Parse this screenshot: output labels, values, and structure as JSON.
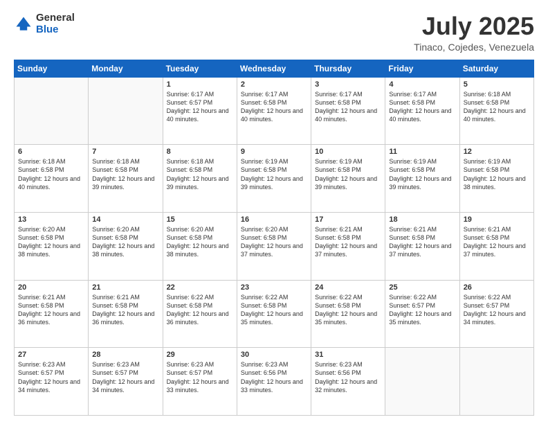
{
  "header": {
    "logo_general": "General",
    "logo_blue": "Blue",
    "month_title": "July 2025",
    "location": "Tinaco, Cojedes, Venezuela"
  },
  "weekdays": [
    "Sunday",
    "Monday",
    "Tuesday",
    "Wednesday",
    "Thursday",
    "Friday",
    "Saturday"
  ],
  "weeks": [
    [
      {
        "day": "",
        "sunrise": "",
        "sunset": "",
        "daylight": ""
      },
      {
        "day": "",
        "sunrise": "",
        "sunset": "",
        "daylight": ""
      },
      {
        "day": "1",
        "sunrise": "Sunrise: 6:17 AM",
        "sunset": "Sunset: 6:57 PM",
        "daylight": "Daylight: 12 hours and 40 minutes."
      },
      {
        "day": "2",
        "sunrise": "Sunrise: 6:17 AM",
        "sunset": "Sunset: 6:58 PM",
        "daylight": "Daylight: 12 hours and 40 minutes."
      },
      {
        "day": "3",
        "sunrise": "Sunrise: 6:17 AM",
        "sunset": "Sunset: 6:58 PM",
        "daylight": "Daylight: 12 hours and 40 minutes."
      },
      {
        "day": "4",
        "sunrise": "Sunrise: 6:17 AM",
        "sunset": "Sunset: 6:58 PM",
        "daylight": "Daylight: 12 hours and 40 minutes."
      },
      {
        "day": "5",
        "sunrise": "Sunrise: 6:18 AM",
        "sunset": "Sunset: 6:58 PM",
        "daylight": "Daylight: 12 hours and 40 minutes."
      }
    ],
    [
      {
        "day": "6",
        "sunrise": "Sunrise: 6:18 AM",
        "sunset": "Sunset: 6:58 PM",
        "daylight": "Daylight: 12 hours and 40 minutes."
      },
      {
        "day": "7",
        "sunrise": "Sunrise: 6:18 AM",
        "sunset": "Sunset: 6:58 PM",
        "daylight": "Daylight: 12 hours and 39 minutes."
      },
      {
        "day": "8",
        "sunrise": "Sunrise: 6:18 AM",
        "sunset": "Sunset: 6:58 PM",
        "daylight": "Daylight: 12 hours and 39 minutes."
      },
      {
        "day": "9",
        "sunrise": "Sunrise: 6:19 AM",
        "sunset": "Sunset: 6:58 PM",
        "daylight": "Daylight: 12 hours and 39 minutes."
      },
      {
        "day": "10",
        "sunrise": "Sunrise: 6:19 AM",
        "sunset": "Sunset: 6:58 PM",
        "daylight": "Daylight: 12 hours and 39 minutes."
      },
      {
        "day": "11",
        "sunrise": "Sunrise: 6:19 AM",
        "sunset": "Sunset: 6:58 PM",
        "daylight": "Daylight: 12 hours and 39 minutes."
      },
      {
        "day": "12",
        "sunrise": "Sunrise: 6:19 AM",
        "sunset": "Sunset: 6:58 PM",
        "daylight": "Daylight: 12 hours and 38 minutes."
      }
    ],
    [
      {
        "day": "13",
        "sunrise": "Sunrise: 6:20 AM",
        "sunset": "Sunset: 6:58 PM",
        "daylight": "Daylight: 12 hours and 38 minutes."
      },
      {
        "day": "14",
        "sunrise": "Sunrise: 6:20 AM",
        "sunset": "Sunset: 6:58 PM",
        "daylight": "Daylight: 12 hours and 38 minutes."
      },
      {
        "day": "15",
        "sunrise": "Sunrise: 6:20 AM",
        "sunset": "Sunset: 6:58 PM",
        "daylight": "Daylight: 12 hours and 38 minutes."
      },
      {
        "day": "16",
        "sunrise": "Sunrise: 6:20 AM",
        "sunset": "Sunset: 6:58 PM",
        "daylight": "Daylight: 12 hours and 37 minutes."
      },
      {
        "day": "17",
        "sunrise": "Sunrise: 6:21 AM",
        "sunset": "Sunset: 6:58 PM",
        "daylight": "Daylight: 12 hours and 37 minutes."
      },
      {
        "day": "18",
        "sunrise": "Sunrise: 6:21 AM",
        "sunset": "Sunset: 6:58 PM",
        "daylight": "Daylight: 12 hours and 37 minutes."
      },
      {
        "day": "19",
        "sunrise": "Sunrise: 6:21 AM",
        "sunset": "Sunset: 6:58 PM",
        "daylight": "Daylight: 12 hours and 37 minutes."
      }
    ],
    [
      {
        "day": "20",
        "sunrise": "Sunrise: 6:21 AM",
        "sunset": "Sunset: 6:58 PM",
        "daylight": "Daylight: 12 hours and 36 minutes."
      },
      {
        "day": "21",
        "sunrise": "Sunrise: 6:21 AM",
        "sunset": "Sunset: 6:58 PM",
        "daylight": "Daylight: 12 hours and 36 minutes."
      },
      {
        "day": "22",
        "sunrise": "Sunrise: 6:22 AM",
        "sunset": "Sunset: 6:58 PM",
        "daylight": "Daylight: 12 hours and 36 minutes."
      },
      {
        "day": "23",
        "sunrise": "Sunrise: 6:22 AM",
        "sunset": "Sunset: 6:58 PM",
        "daylight": "Daylight: 12 hours and 35 minutes."
      },
      {
        "day": "24",
        "sunrise": "Sunrise: 6:22 AM",
        "sunset": "Sunset: 6:58 PM",
        "daylight": "Daylight: 12 hours and 35 minutes."
      },
      {
        "day": "25",
        "sunrise": "Sunrise: 6:22 AM",
        "sunset": "Sunset: 6:57 PM",
        "daylight": "Daylight: 12 hours and 35 minutes."
      },
      {
        "day": "26",
        "sunrise": "Sunrise: 6:22 AM",
        "sunset": "Sunset: 6:57 PM",
        "daylight": "Daylight: 12 hours and 34 minutes."
      }
    ],
    [
      {
        "day": "27",
        "sunrise": "Sunrise: 6:23 AM",
        "sunset": "Sunset: 6:57 PM",
        "daylight": "Daylight: 12 hours and 34 minutes."
      },
      {
        "day": "28",
        "sunrise": "Sunrise: 6:23 AM",
        "sunset": "Sunset: 6:57 PM",
        "daylight": "Daylight: 12 hours and 34 minutes."
      },
      {
        "day": "29",
        "sunrise": "Sunrise: 6:23 AM",
        "sunset": "Sunset: 6:57 PM",
        "daylight": "Daylight: 12 hours and 33 minutes."
      },
      {
        "day": "30",
        "sunrise": "Sunrise: 6:23 AM",
        "sunset": "Sunset: 6:56 PM",
        "daylight": "Daylight: 12 hours and 33 minutes."
      },
      {
        "day": "31",
        "sunrise": "Sunrise: 6:23 AM",
        "sunset": "Sunset: 6:56 PM",
        "daylight": "Daylight: 12 hours and 32 minutes."
      },
      {
        "day": "",
        "sunrise": "",
        "sunset": "",
        "daylight": ""
      },
      {
        "day": "",
        "sunrise": "",
        "sunset": "",
        "daylight": ""
      }
    ]
  ]
}
